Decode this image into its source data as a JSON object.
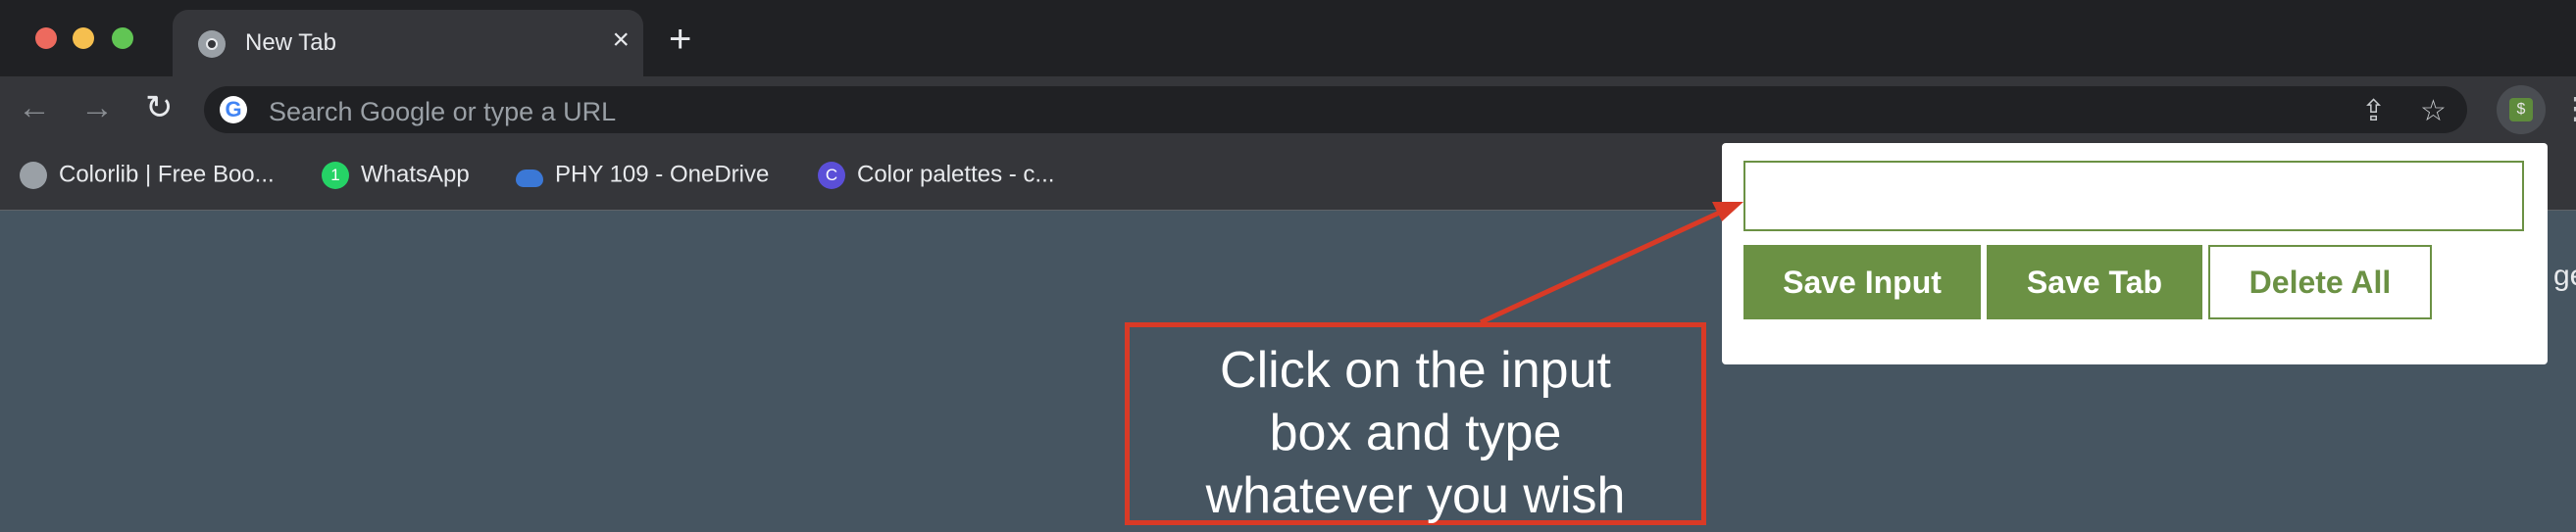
{
  "browser": {
    "tab": {
      "title": "New Tab",
      "close_glyph": "×"
    },
    "new_tab_glyph": "+",
    "nav": {
      "back": "←",
      "forward": "→",
      "reload": "↻"
    },
    "omnibox": {
      "placeholder": "Search Google or type a URL",
      "g_letter": "G"
    },
    "icons": {
      "share": "⇪",
      "star": "☆",
      "extension": "$",
      "menu": "⋮"
    },
    "traffic_lights": [
      "#ed6a5e",
      "#f5bf4f",
      "#61c554"
    ]
  },
  "bookmarks": [
    {
      "label": "Colorlib | Free Boo...",
      "icon": "globe-icon",
      "color": "#9aa0a6",
      "glyph": ""
    },
    {
      "label": "WhatsApp",
      "icon": "whatsapp-icon",
      "color": "#25d366",
      "glyph": "1"
    },
    {
      "label": "PHY 109 - OneDrive",
      "icon": "onedrive-icon",
      "color": "#3b78d6",
      "glyph": ""
    },
    {
      "label": "Color palettes - c...",
      "icon": "canva-icon",
      "color": "#5b4fd8",
      "glyph": "C"
    }
  ],
  "popup": {
    "input_value": "",
    "buttons": {
      "save_input": "Save Input",
      "save_tab": "Save Tab",
      "delete_all": "Delete All"
    },
    "accent": "#6b9144"
  },
  "page_peek": "ge",
  "annotation": {
    "text_line1": "Click on the input",
    "text_line2": "box and type",
    "text_line3": "whatever you wish",
    "color": "#d93a26"
  }
}
